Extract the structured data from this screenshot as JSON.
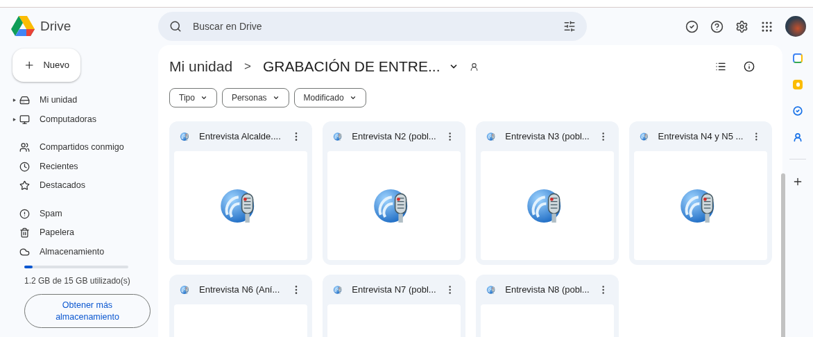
{
  "app": {
    "name": "Drive"
  },
  "search": {
    "placeholder": "Buscar en Drive"
  },
  "new_button": {
    "label": "Nuevo"
  },
  "sidebar": {
    "items": [
      {
        "label": "Mi unidad",
        "kind": "expandable"
      },
      {
        "label": "Computadoras",
        "kind": "expandable"
      },
      {
        "label": "Compartidos conmigo",
        "kind": "plain"
      },
      {
        "label": "Recientes",
        "kind": "plain"
      },
      {
        "label": "Destacados",
        "kind": "plain"
      },
      {
        "label": "Spam",
        "kind": "plain"
      },
      {
        "label": "Papelera",
        "kind": "plain"
      },
      {
        "label": "Almacenamiento",
        "kind": "plain"
      }
    ]
  },
  "storage": {
    "level": 0.08,
    "text": "1.2 GB de 15 GB utilizado(s)",
    "button": "Obtener más almacenamiento"
  },
  "breadcrumb": {
    "root": "Mi unidad",
    "separator": ">",
    "current": "GRABACIÓN DE ENTRE..."
  },
  "filters": [
    "Tipo",
    "Personas",
    "Modificado"
  ],
  "files": [
    {
      "name": "Entrevista Alcalde...."
    },
    {
      "name": "Entrevista N2 (pobl..."
    },
    {
      "name": "Entrevista N3 (pobl..."
    },
    {
      "name": "Entrevista N4 y N5 ..."
    },
    {
      "name": "Entrevista N6 (Aní..."
    },
    {
      "name": "Entrevista N7 (pobl..."
    },
    {
      "name": "Entrevista N8 (pobl..."
    }
  ]
}
